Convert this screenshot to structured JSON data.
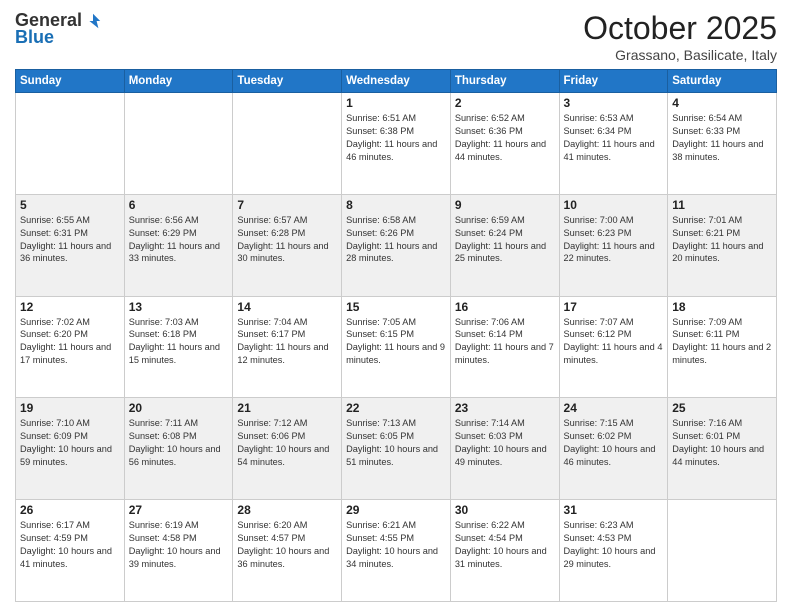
{
  "logo": {
    "general": "General",
    "blue": "Blue"
  },
  "title": "October 2025",
  "location": "Grassano, Basilicate, Italy",
  "days_of_week": [
    "Sunday",
    "Monday",
    "Tuesday",
    "Wednesday",
    "Thursday",
    "Friday",
    "Saturday"
  ],
  "weeks": [
    [
      {
        "day": "",
        "info": ""
      },
      {
        "day": "",
        "info": ""
      },
      {
        "day": "",
        "info": ""
      },
      {
        "day": "1",
        "info": "Sunrise: 6:51 AM\nSunset: 6:38 PM\nDaylight: 11 hours and 46 minutes."
      },
      {
        "day": "2",
        "info": "Sunrise: 6:52 AM\nSunset: 6:36 PM\nDaylight: 11 hours and 44 minutes."
      },
      {
        "day": "3",
        "info": "Sunrise: 6:53 AM\nSunset: 6:34 PM\nDaylight: 11 hours and 41 minutes."
      },
      {
        "day": "4",
        "info": "Sunrise: 6:54 AM\nSunset: 6:33 PM\nDaylight: 11 hours and 38 minutes."
      }
    ],
    [
      {
        "day": "5",
        "info": "Sunrise: 6:55 AM\nSunset: 6:31 PM\nDaylight: 11 hours and 36 minutes."
      },
      {
        "day": "6",
        "info": "Sunrise: 6:56 AM\nSunset: 6:29 PM\nDaylight: 11 hours and 33 minutes."
      },
      {
        "day": "7",
        "info": "Sunrise: 6:57 AM\nSunset: 6:28 PM\nDaylight: 11 hours and 30 minutes."
      },
      {
        "day": "8",
        "info": "Sunrise: 6:58 AM\nSunset: 6:26 PM\nDaylight: 11 hours and 28 minutes."
      },
      {
        "day": "9",
        "info": "Sunrise: 6:59 AM\nSunset: 6:24 PM\nDaylight: 11 hours and 25 minutes."
      },
      {
        "day": "10",
        "info": "Sunrise: 7:00 AM\nSunset: 6:23 PM\nDaylight: 11 hours and 22 minutes."
      },
      {
        "day": "11",
        "info": "Sunrise: 7:01 AM\nSunset: 6:21 PM\nDaylight: 11 hours and 20 minutes."
      }
    ],
    [
      {
        "day": "12",
        "info": "Sunrise: 7:02 AM\nSunset: 6:20 PM\nDaylight: 11 hours and 17 minutes."
      },
      {
        "day": "13",
        "info": "Sunrise: 7:03 AM\nSunset: 6:18 PM\nDaylight: 11 hours and 15 minutes."
      },
      {
        "day": "14",
        "info": "Sunrise: 7:04 AM\nSunset: 6:17 PM\nDaylight: 11 hours and 12 minutes."
      },
      {
        "day": "15",
        "info": "Sunrise: 7:05 AM\nSunset: 6:15 PM\nDaylight: 11 hours and 9 minutes."
      },
      {
        "day": "16",
        "info": "Sunrise: 7:06 AM\nSunset: 6:14 PM\nDaylight: 11 hours and 7 minutes."
      },
      {
        "day": "17",
        "info": "Sunrise: 7:07 AM\nSunset: 6:12 PM\nDaylight: 11 hours and 4 minutes."
      },
      {
        "day": "18",
        "info": "Sunrise: 7:09 AM\nSunset: 6:11 PM\nDaylight: 11 hours and 2 minutes."
      }
    ],
    [
      {
        "day": "19",
        "info": "Sunrise: 7:10 AM\nSunset: 6:09 PM\nDaylight: 10 hours and 59 minutes."
      },
      {
        "day": "20",
        "info": "Sunrise: 7:11 AM\nSunset: 6:08 PM\nDaylight: 10 hours and 56 minutes."
      },
      {
        "day": "21",
        "info": "Sunrise: 7:12 AM\nSunset: 6:06 PM\nDaylight: 10 hours and 54 minutes."
      },
      {
        "day": "22",
        "info": "Sunrise: 7:13 AM\nSunset: 6:05 PM\nDaylight: 10 hours and 51 minutes."
      },
      {
        "day": "23",
        "info": "Sunrise: 7:14 AM\nSunset: 6:03 PM\nDaylight: 10 hours and 49 minutes."
      },
      {
        "day": "24",
        "info": "Sunrise: 7:15 AM\nSunset: 6:02 PM\nDaylight: 10 hours and 46 minutes."
      },
      {
        "day": "25",
        "info": "Sunrise: 7:16 AM\nSunset: 6:01 PM\nDaylight: 10 hours and 44 minutes."
      }
    ],
    [
      {
        "day": "26",
        "info": "Sunrise: 6:17 AM\nSunset: 4:59 PM\nDaylight: 10 hours and 41 minutes."
      },
      {
        "day": "27",
        "info": "Sunrise: 6:19 AM\nSunset: 4:58 PM\nDaylight: 10 hours and 39 minutes."
      },
      {
        "day": "28",
        "info": "Sunrise: 6:20 AM\nSunset: 4:57 PM\nDaylight: 10 hours and 36 minutes."
      },
      {
        "day": "29",
        "info": "Sunrise: 6:21 AM\nSunset: 4:55 PM\nDaylight: 10 hours and 34 minutes."
      },
      {
        "day": "30",
        "info": "Sunrise: 6:22 AM\nSunset: 4:54 PM\nDaylight: 10 hours and 31 minutes."
      },
      {
        "day": "31",
        "info": "Sunrise: 6:23 AM\nSunset: 4:53 PM\nDaylight: 10 hours and 29 minutes."
      },
      {
        "day": "",
        "info": ""
      }
    ]
  ]
}
